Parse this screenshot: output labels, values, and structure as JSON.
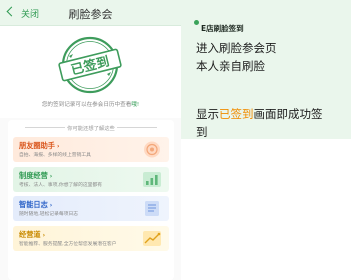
{
  "navbar": {
    "close_label": "关闭",
    "title": "刷脸参会"
  },
  "hero": {
    "stamp_text": "已签到",
    "note_prefix": "您的签到记录可以在参会日历中查看",
    "note_link": "哦!"
  },
  "tips": {
    "header": "你可能还想了解这些",
    "cards": [
      {
        "title": "朋友圈助手",
        "arrow": "›",
        "desc": "自拍、海报、多样的线上营销工具",
        "icon": "poster-art-icon"
      },
      {
        "title": "制度经营",
        "arrow": "›",
        "desc": "考核、法人、事项,你想了解的这里都有",
        "icon": "growth-chart-icon"
      },
      {
        "title": "智能日志",
        "arrow": "›",
        "desc": "随时随地,轻松记录每项日志",
        "icon": "notebook-icon"
      },
      {
        "title": "经营道",
        "arrow": "›",
        "desc": "智能推荐、服务提醒,全方位帮您发展潜在客户",
        "icon": "trend-chart-icon"
      }
    ]
  },
  "annotation": {
    "heading": "E店刷脸签到",
    "line1": "进入刷脸参会页",
    "line2": "本人亲自刷脸",
    "line3_prefix": "显示",
    "line3_highlight": "已签到",
    "line3_suffix": "画面即成功签",
    "line4": "到"
  },
  "colors": {
    "brand_green": "#2f9a52",
    "highlight_orange": "#f08c00",
    "panel_bg": "#eaf6ec"
  }
}
